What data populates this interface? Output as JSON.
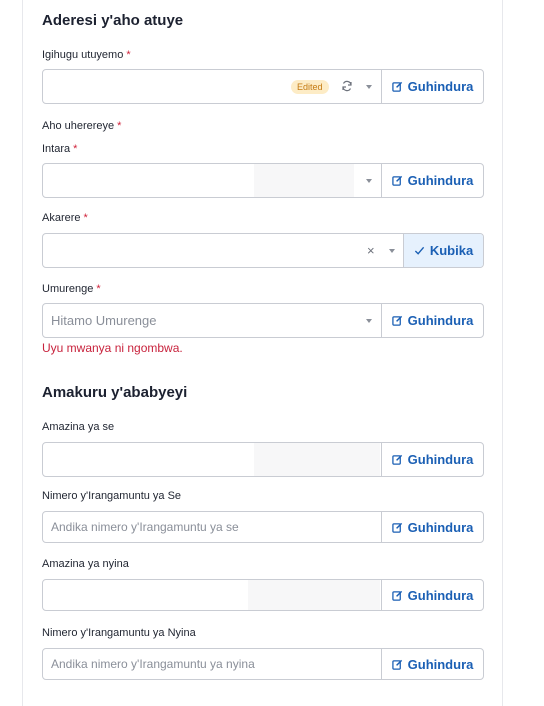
{
  "address": {
    "title": "Aderesi y'aho atuye",
    "country": {
      "label": "Igihugu utuyemo",
      "required": "*",
      "badge": "Edited",
      "button": "Guhindura"
    },
    "residence_label": "Aho uherereye",
    "residence_required": "*",
    "province": {
      "label": "Intara",
      "required": "*",
      "button": "Guhindura"
    },
    "district": {
      "label": "Akarere",
      "required": "*",
      "clear": "×",
      "button": "Kubika"
    },
    "sector": {
      "label": "Umurenge",
      "required": "*",
      "placeholder": "Hitamo Umurenge",
      "button": "Guhindura",
      "error": "Uyu mwanya ni ngombwa."
    }
  },
  "parents": {
    "title": "Amakuru y'ababyeyi",
    "father_name": {
      "label": "Amazina ya se",
      "button": "Guhindura"
    },
    "father_id": {
      "label": "Nimero y'Irangamuntu ya Se",
      "placeholder": "Andika nimero y'Irangamuntu ya se",
      "button": "Guhindura"
    },
    "mother_name": {
      "label": "Amazina ya nyina",
      "button": "Guhindura"
    },
    "mother_id": {
      "label": "Nimero y'Irangamuntu ya Nyina",
      "placeholder": "Andika nimero y'Irangamuntu ya nyina",
      "button": "Guhindura"
    }
  },
  "colors": {
    "accent": "#1a5fb4",
    "required": "#d0223a",
    "error": "#c8233d",
    "badge_bg": "#fdecc6",
    "badge_text": "#c47a12",
    "confirm_bg": "#e6f1fd"
  }
}
